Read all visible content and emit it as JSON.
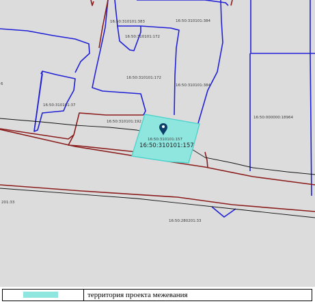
{
  "map": {
    "colors": {
      "background": "#dcdcdc",
      "parcel_border": "#1f1fd6",
      "road_border": "#8b1c1c",
      "project_fill": "#8ee6df",
      "project_border": "#4fd3cc",
      "label": "#3a3a3a"
    },
    "labels": {
      "l383": "16:50:310101:383",
      "l384a": "16:50:310101:384",
      "l172a": "16:50:310101:172",
      "l172b": "16:50:310101:172",
      "l384b": "16:50:310101:384",
      "l37": "16:50:310101:37",
      "l192": "16:50:310101:192",
      "l157a": "16:50:310101:157",
      "l18964": "16:50:000000:18964",
      "l33a": "201:33",
      "l33b": "16:50:280201:33",
      "l157main": "16:50:310101:157",
      "edge_digit": "6"
    },
    "marker_icon": "map-pin-icon"
  },
  "legend": {
    "swatch_color": "#8ee6df",
    "text": "территория проекта межевания"
  }
}
